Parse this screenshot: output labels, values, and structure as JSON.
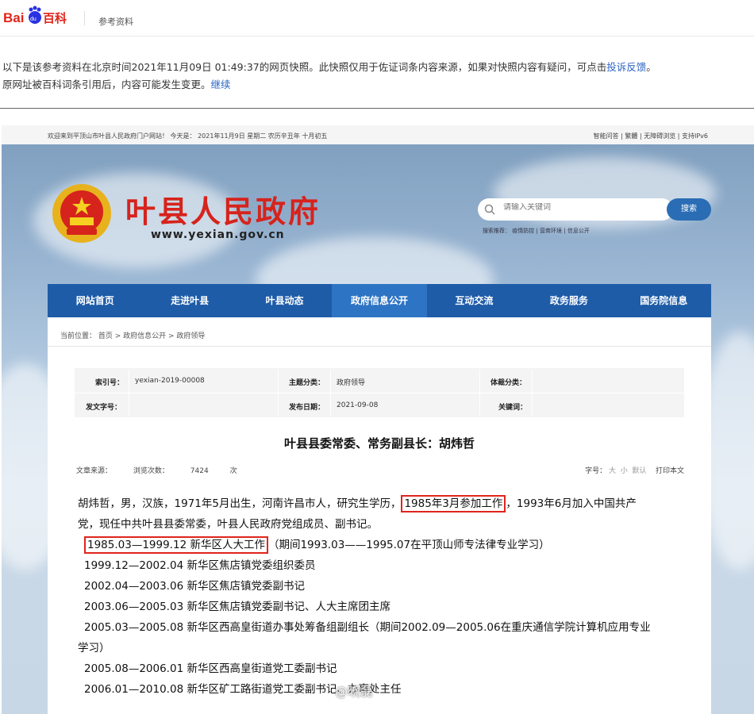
{
  "baidu": {
    "logo_text": "Bai du 百科",
    "reference_label": "参考资料",
    "notice_line1": "以下是该参考资料在北京时间2021年11月09日 01:49:37的网页快照。此快照仅用于佐证词条内容来源，如果对快照内容有疑问，可点击",
    "notice_link1": "投诉反馈",
    "notice_line1_end": "。",
    "notice_line2": "原网址被百科词条引用后，内容可能发生变更。",
    "notice_link2": "继续"
  },
  "site": {
    "topbar_left": "欢迎来到平顶山市叶县人民政府门户网站！ 今天是： 2021年11月9日 星期二 农历辛丑年 十月初五",
    "topbar_right": "智能问答 | 繁體 | 无障碍浏览 | 支持IPv6",
    "title": "叶县人民政府",
    "url": "www.yexian.gov.cn",
    "search_placeholder": "请输入关键词",
    "search_button": "搜索",
    "hot_search": "搜索推荐： 疫情防控  |  营商环境  |  信息公开",
    "nav": [
      "网站首页",
      "走进叶县",
      "叶县动态",
      "政府信息公开",
      "互动交流",
      "政务服务",
      "国务院信息"
    ],
    "active_nav": 3
  },
  "breadcrumb": "当前位置：  首页  >  政府信息公开  >  政府领导",
  "meta": {
    "index_label": "索引号：",
    "index_value": "yexian-2019-00008",
    "topic_label": "主题分类：",
    "topic_value": "政府领导",
    "genre_label": "体裁分类：",
    "genre_value": "",
    "docno_label": "发文字号：",
    "docno_value": "",
    "date_label": "发布日期：",
    "date_value": "2021-09-08",
    "keyword_label": "关键词：",
    "keyword_value": ""
  },
  "article": {
    "title": "叶县县委常委、常务副县长：胡炜哲",
    "source_label": "文章来源：",
    "views_label": "浏览次数：",
    "views_count": "7424",
    "views_unit": "次",
    "font_label": "字号：",
    "font_large": "大",
    "font_small": "小",
    "font_default": "默认",
    "print": "打印本文",
    "intro_a": "胡炜哲，男，汉族，1971年5月出生，河南许昌市人，研究生学历，",
    "intro_highlight": "1985年3月参加工作",
    "intro_b": "，1993年6月加入中国共产",
    "intro_c": "党，现任中共叶县县委常委，叶县人民政府党组成员、副书记。",
    "career1_highlight": "1985.03—1999.12 新华区人大工作",
    "career1_rest": "（期间1993.03——1995.07在平顶山师专法律专业学习）",
    "career2": "1999.12—2002.04  新华区焦店镇党委组织委员",
    "career3": "2002.04—2003.06  新华区焦店镇党委副书记",
    "career4": "2003.06—2005.03  新华区焦店镇党委副书记、人大主席团主席",
    "career5a": "2005.03—2005.08  新华区西高皇街道办事处筹备组副组长（期间2002.09—2005.06在重庆通信学院计算机应用专业",
    "career5b": "学习）",
    "career6": "2005.08—2006.01  新华区西高皇街道党工委副书记",
    "career7": "2006.01—2010.08  新华区矿工路街道党工委副书记、办事处主任"
  },
  "watermark": "@晓磊",
  "colors": {
    "nav_bg": "#1e5ca8",
    "title_red": "#d6231c",
    "highlight_box": "#e0241c",
    "link": "#2a64c6"
  }
}
